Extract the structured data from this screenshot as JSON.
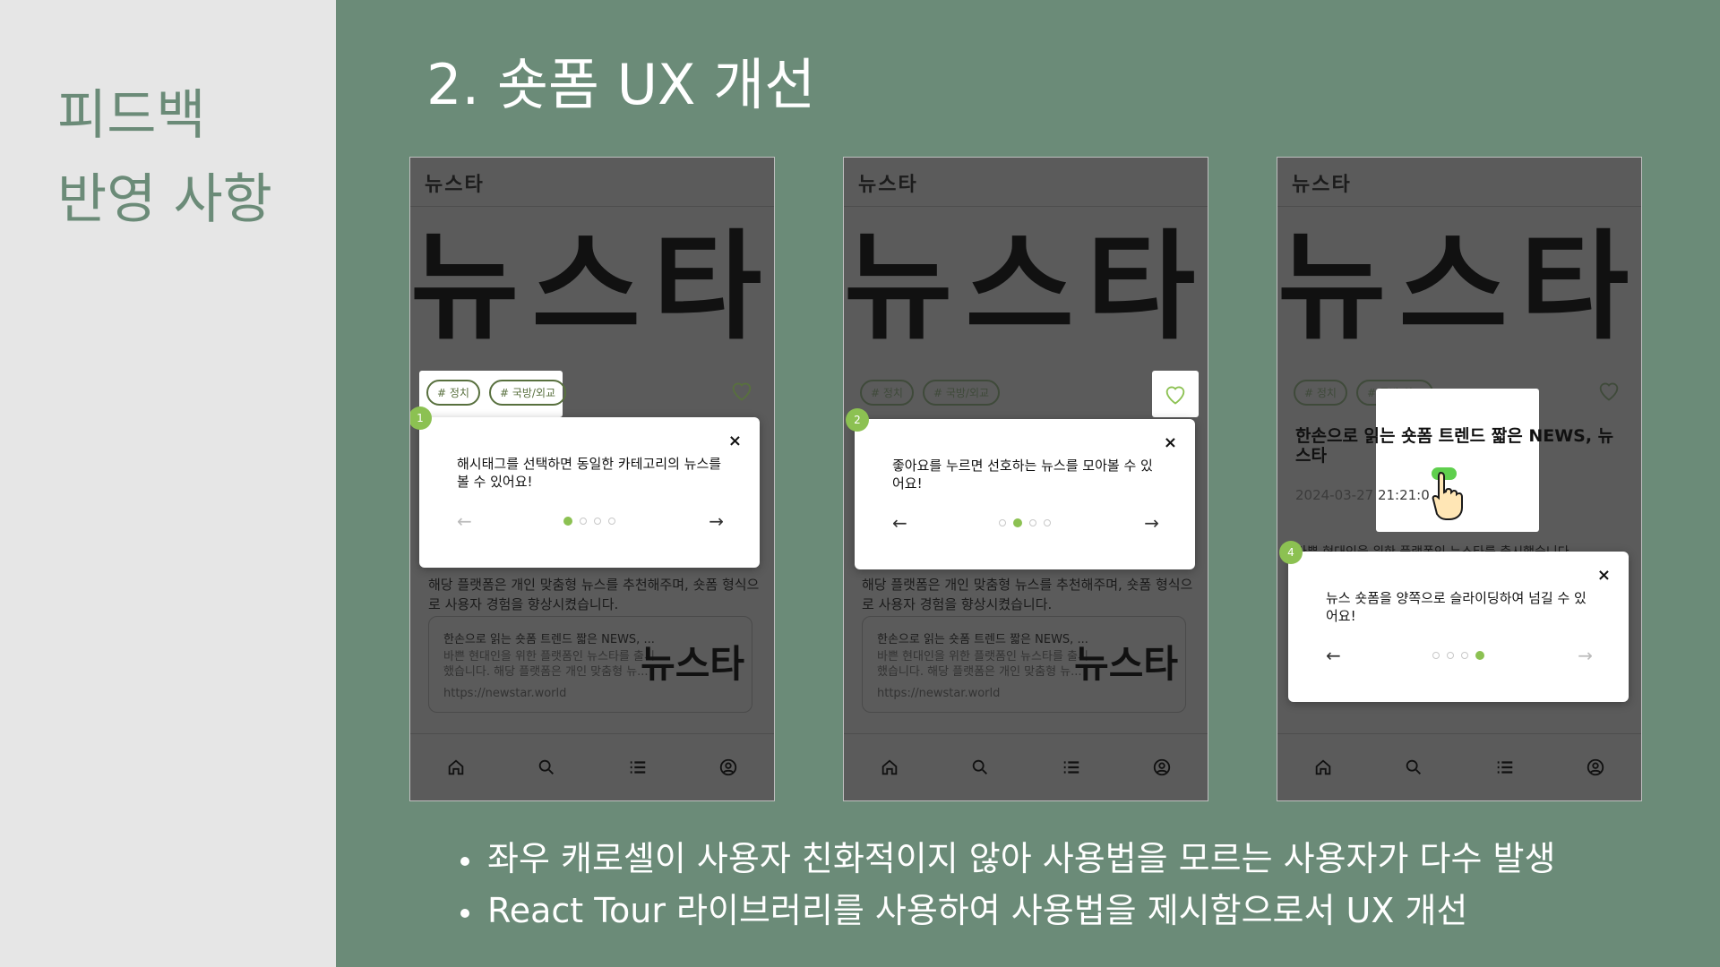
{
  "sidebar": {
    "title_line1": "피드백",
    "title_line2": "반영 사항"
  },
  "main": {
    "title": "2. 숏폼 UX 개선"
  },
  "app": {
    "header_title": "뉴스타",
    "logo_text": "뉴스타",
    "hashtags": [
      "# 정치",
      "# 국방/외교"
    ],
    "article_title": "한손으로 읽는 숏폼 트렌드 짧은 NEWS, 뉴스타",
    "article_date": "2024-03-27 21:21:0",
    "article_body": "해당 플랫폼은 개인 맞춤형 뉴스를 추천해주며, 숏폼 형식으로 사용자 경험을 향상시켰습니다.",
    "article_body_partial": "바쁜 현대인을 위한 플랫폼인 뉴스타를 출시했습니다",
    "link_card": {
      "title": "한손으로 읽는 숏폼 트렌드 짧은 NEWS, ...",
      "desc": "바쁜 현대인을 위한 플랫폼인 뉴스타를 출시했습니다. 해당 플랫폼은 개인 맞춤형 뉴...",
      "url": "https://newstar.world",
      "logo": "뉴스타"
    }
  },
  "tour_steps": [
    {
      "step": "1",
      "text": "해시태그를 선택하면 동일한 카테고리의 뉴스를 볼 수 있어요!",
      "close": "×",
      "prev": "←",
      "next": "→"
    },
    {
      "step": "2",
      "text": "좋아요를 누르면 선호하는 뉴스를 모아볼 수 있어요!",
      "close": "×",
      "prev": "←",
      "next": "→"
    },
    {
      "step": "4",
      "text": "뉴스 숏폼을 양쪽으로 슬라이딩하여 넘길 수 있어요!",
      "close": "×",
      "prev": "←",
      "next": "→"
    }
  ],
  "tour_progress": {
    "total_steps": 4,
    "phone1_active": 1,
    "phone2_active": 2,
    "phone3_active": 4
  },
  "bullets": [
    "좌우 캐로셀이 사용자 친화적이지 않아 사용법을 모르는 사용자가 다수 발생",
    "React Tour 라이브러리를 사용하여 사용법을 제시함으로서 UX 개선"
  ],
  "colors": {
    "accent": "#8cc152",
    "background": "#6b8b78",
    "sidebar": "#e6e6e6",
    "overlay": "#5b5b5b"
  },
  "icons": [
    "home-icon",
    "search-icon",
    "list-icon",
    "profile-icon",
    "heart-icon",
    "pointing-hand-icon"
  ]
}
